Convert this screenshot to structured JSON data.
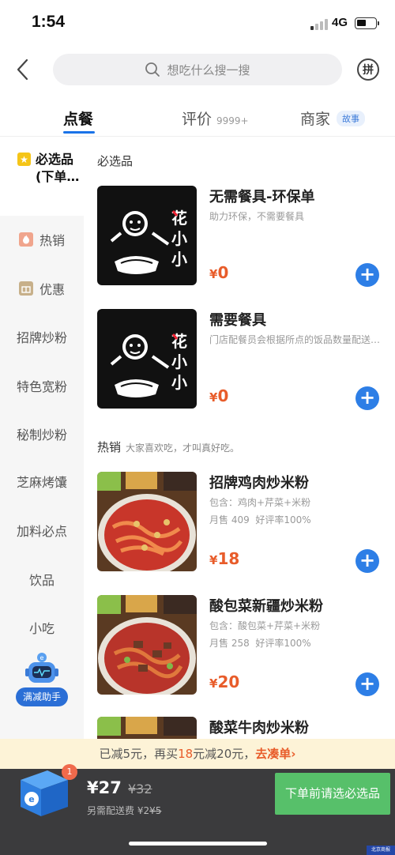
{
  "status_bar": {
    "time": "1:54",
    "network": "4G"
  },
  "search": {
    "placeholder": "想吃什么搜一搜"
  },
  "header": {
    "group_icon_label": "拼"
  },
  "tabs": [
    {
      "label": "点餐",
      "active": true
    },
    {
      "label": "评价",
      "sub": "9999+"
    },
    {
      "label": "商家",
      "badge": "故事"
    }
  ],
  "sidebar": {
    "items": [
      {
        "label": "必选品",
        "label2": "(下单…",
        "selected": true
      },
      {
        "label": "热销",
        "icon": "fire-icon"
      },
      {
        "label": "优惠",
        "icon": "gift-icon"
      },
      {
        "label": "招牌炒粉"
      },
      {
        "label": "特色宽粉"
      },
      {
        "label": "秘制炒粉"
      },
      {
        "label": "芝麻烤馕"
      },
      {
        "label": "加料必点"
      },
      {
        "label": "饮品"
      },
      {
        "label": "小吃"
      }
    ],
    "helper_label": "满减助手"
  },
  "sections": [
    {
      "title": "必选品",
      "desc": ""
    },
    {
      "title": "热销",
      "desc": "大家喜欢吃，才叫真好吃。"
    }
  ],
  "items": [
    {
      "name": "无需餐具-环保单",
      "desc": "助力环保，不需要餐具",
      "price_symbol": "¥",
      "price": "0",
      "logo_text": "花小小"
    },
    {
      "name": "需要餐具",
      "desc": "门店配餐员会根据所点的饭品数量配送餐具",
      "price_symbol": "¥",
      "price": "0",
      "logo_text": "花小小"
    },
    {
      "name": "招牌鸡肉炒米粉",
      "desc": "包含：鸡肉+芹菜+米粉",
      "sales": "月售 409",
      "rating": "好评率100%",
      "price_symbol": "¥",
      "price": "18"
    },
    {
      "name": "酸包菜新疆炒米粉",
      "desc": "包含：酸包菜+芹菜+米粉",
      "sales": "月售 258",
      "rating": "好评率100%",
      "price_symbol": "¥",
      "price": "20"
    },
    {
      "name": "酸菜牛肉炒米粉"
    }
  ],
  "promo": {
    "part1": "已减5元，再买",
    "amount": "18",
    "part2": "元减20元，",
    "link": "去凑单",
    "chevron": "›"
  },
  "cart": {
    "badge": "1",
    "total": "¥27",
    "original": "¥32",
    "delivery_prefix": "另需配送费",
    "delivery_now": "¥2",
    "delivery_old": "¥5",
    "checkout_label": "下单前请选必选品"
  },
  "watermark": "北京商报",
  "colors": {
    "accent": "#2d7ee6",
    "price": "#e85c2a",
    "checkout": "#57c06a",
    "cart_bar": "#3b3b3d",
    "promo_bg": "#fdf3d7"
  }
}
